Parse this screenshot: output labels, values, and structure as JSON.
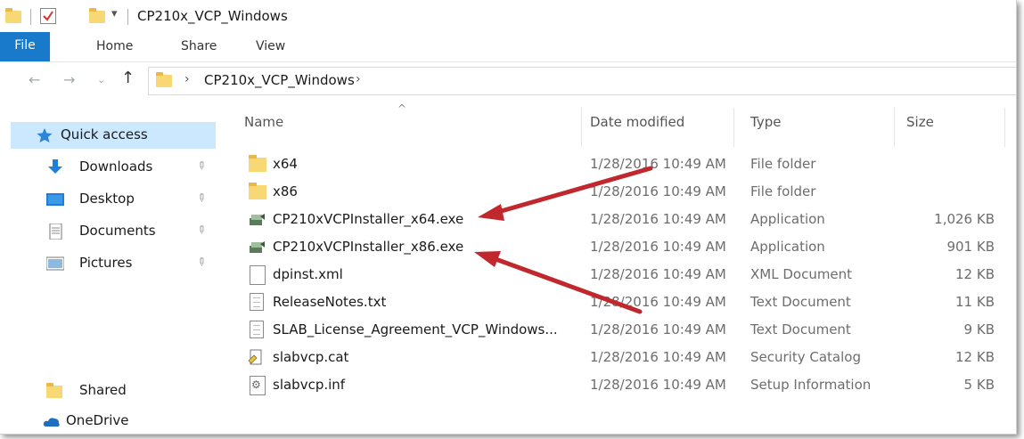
{
  "window": {
    "title": "CP210x_VCP_Windows"
  },
  "ribbon": {
    "tabs": [
      "File",
      "Home",
      "Share",
      "View"
    ]
  },
  "address": {
    "path": "CP210x_VCP_Windows"
  },
  "sidebar": {
    "items": [
      {
        "label": "Quick access",
        "icon": "star-icon"
      },
      {
        "label": "Downloads",
        "icon": "download-arrow-icon"
      },
      {
        "label": "Desktop",
        "icon": "desktop-icon"
      },
      {
        "label": "Documents",
        "icon": "documents-icon"
      },
      {
        "label": "Pictures",
        "icon": "pictures-icon"
      },
      {
        "label": "Shared",
        "icon": "folder-icon"
      },
      {
        "label": "OneDrive",
        "icon": "cloud-icon"
      }
    ]
  },
  "columns": {
    "name": "Name",
    "date": "Date modified",
    "type": "Type",
    "size": "Size"
  },
  "files": [
    {
      "name": "x64",
      "date": "1/28/2016 10:49 AM",
      "type": "File folder",
      "size": "",
      "icon": "folder-icon"
    },
    {
      "name": "x86",
      "date": "1/28/2016 10:49 AM",
      "type": "File folder",
      "size": "",
      "icon": "folder-icon"
    },
    {
      "name": "CP210xVCPInstaller_x64.exe",
      "date": "1/28/2016 10:49 AM",
      "type": "Application",
      "size": "1,026 KB",
      "icon": "installer-icon"
    },
    {
      "name": "CP210xVCPInstaller_x86.exe",
      "date": "1/28/2016 10:49 AM",
      "type": "Application",
      "size": "901 KB",
      "icon": "installer-icon"
    },
    {
      "name": "dpinst.xml",
      "date": "1/28/2016 10:49 AM",
      "type": "XML Document",
      "size": "12 KB",
      "icon": "document-icon"
    },
    {
      "name": "ReleaseNotes.txt",
      "date": "1/28/2016 10:49 AM",
      "type": "Text Document",
      "size": "11 KB",
      "icon": "text-document-icon"
    },
    {
      "name": "SLAB_License_Agreement_VCP_Windows...",
      "date": "1/28/2016 10:49 AM",
      "type": "Text Document",
      "size": "9 KB",
      "icon": "text-document-icon"
    },
    {
      "name": "slabvcp.cat",
      "date": "1/28/2016 10:49 AM",
      "type": "Security Catalog",
      "size": "12 KB",
      "icon": "security-catalog-icon"
    },
    {
      "name": "slabvcp.inf",
      "date": "1/28/2016 10:49 AM",
      "type": "Setup Information",
      "size": "5 KB",
      "icon": "setup-info-icon"
    }
  ],
  "colors": {
    "accent": "#1979ca",
    "selection": "#cce8ff",
    "annotation_arrow": "#c0282d"
  }
}
